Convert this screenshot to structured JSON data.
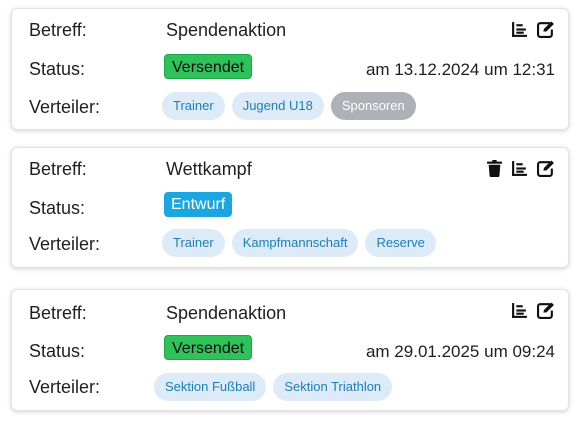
{
  "labels": {
    "subject": "Betreff:",
    "status": "Status:",
    "distribution": "Verteiler:"
  },
  "messages": [
    {
      "subject": "Spendenaktion",
      "status": "Versendet",
      "status_color": "#2fc25b",
      "sent_at": "am 13.12.2024 um 12:31",
      "distribution": [
        "Trainer",
        "Jugend U18",
        "Sponsoren"
      ],
      "actions": [
        "list-icon",
        "edit-icon"
      ]
    },
    {
      "subject": "Wettkampf",
      "status": "Entwurf",
      "status_color": "#1aa6e0",
      "distribution": [
        "Trainer",
        "Kampfmannschaft",
        "Reserve"
      ],
      "actions": [
        "trash-icon",
        "list-icon",
        "edit-icon"
      ]
    },
    {
      "subject": "Spendenaktion",
      "status": "Versendet",
      "status_color": "#2fc25b",
      "sent_at": "am 29.01.2025 um 09:24",
      "distribution": [
        "Sektion Fußball",
        "Sektion Triathlon"
      ],
      "actions": [
        "list-icon",
        "edit-icon"
      ]
    }
  ],
  "colors": {
    "chip_bg": "#dcebf7",
    "chip_text": "#1c7fb5",
    "chip_inactive_bg": "#aeb1b5"
  }
}
